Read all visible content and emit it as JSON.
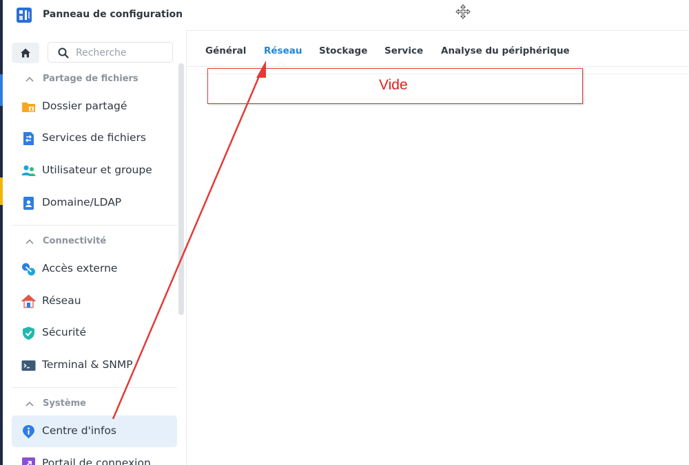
{
  "window": {
    "title": "Panneau de configuration"
  },
  "search": {
    "placeholder": "Recherche"
  },
  "sidebar": {
    "sections": [
      {
        "title": "Partage de fichiers"
      },
      {
        "title": "Connectivité"
      },
      {
        "title": "Système"
      }
    ],
    "items": [
      {
        "label": "Dossier partagé",
        "icon": "shared-folder-icon"
      },
      {
        "label": "Services de fichiers",
        "icon": "file-services-icon"
      },
      {
        "label": "Utilisateur et groupe",
        "icon": "user-group-icon"
      },
      {
        "label": "Domaine/LDAP",
        "icon": "domain-ldap-icon"
      },
      {
        "label": "Accès externe",
        "icon": "external-access-icon"
      },
      {
        "label": "Réseau",
        "icon": "network-icon"
      },
      {
        "label": "Sécurité",
        "icon": "security-shield-icon"
      },
      {
        "label": "Terminal & SNMP",
        "icon": "terminal-icon"
      },
      {
        "label": "Centre d'infos",
        "icon": "info-center-icon",
        "active": true
      },
      {
        "label": "Portail de connexion",
        "icon": "login-portal-icon"
      }
    ]
  },
  "tabs": [
    {
      "label": "Général"
    },
    {
      "label": "Réseau",
      "active": true
    },
    {
      "label": "Stockage"
    },
    {
      "label": "Service"
    },
    {
      "label": "Analyse du périphérique"
    }
  ],
  "annotation": {
    "text": "Vide"
  },
  "colors": {
    "accent": "#1f86d6",
    "active_bg": "#e6f0fb",
    "annotation": "#e53935"
  }
}
